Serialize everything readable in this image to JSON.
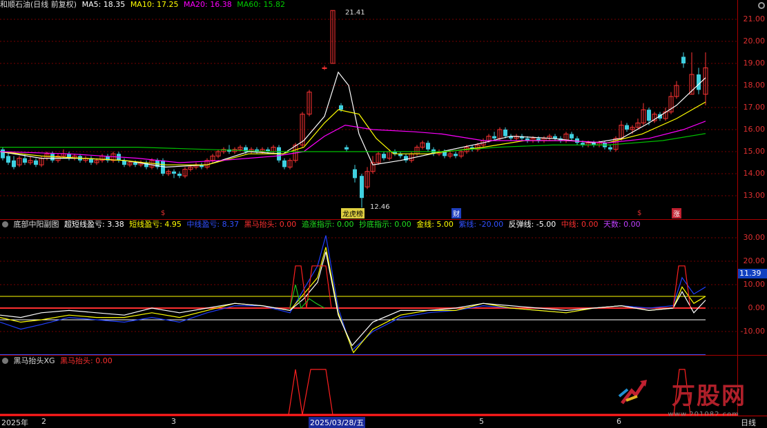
{
  "main_legend": {
    "title": "和顺石油(日线 前复权)",
    "ma5": "MA5: 18.35",
    "ma10": "MA10: 17.25",
    "ma20": "MA20: 16.38",
    "ma60": "MA60: 15.82"
  },
  "main_axis_ticks": [
    "21.00",
    "20.00",
    "19.00",
    "18.00",
    "17.00",
    "16.00",
    "15.00",
    "14.00",
    "13.00"
  ],
  "annotations": {
    "high": "21.41",
    "low": "12.46",
    "marker_1": "$",
    "marker_2": "$",
    "tag_rank": "龙虎榜",
    "tag_finance": "财",
    "tag_up": "涨"
  },
  "sub1_legend": {
    "name": "底部中阳副图",
    "item1": "超短线盈亏: 3.38",
    "item2": "短线盈亏: 4.95",
    "item3": "中线盈亏: 8.37",
    "item4": "黑马抬头: 0.00",
    "item5": "追涨指示: 0.00",
    "item6": "抄底指示: 0.00",
    "item7": "金线: 5.00",
    "item8": "紫线: -20.00",
    "item9": "反弹线: -5.00",
    "item10": "中线: 0.00",
    "item11": "天数: 0.00"
  },
  "sub1_axis_ticks": [
    "30.00",
    "20.00",
    "10.00",
    "0.00",
    "-10.00"
  ],
  "sub1_current": "11.39",
  "sub2_legend": {
    "name": "黑马抬头XG",
    "item1": "黑马抬头: 0.00"
  },
  "date_axis": {
    "d1": "2025年",
    "d2": "2",
    "d3": "3",
    "d4": "2025/03/28/五",
    "d5": "5",
    "d6": "6",
    "period": "日线"
  },
  "watermark": {
    "logo": "万股网",
    "url": "www.201082.com"
  },
  "colors": {
    "up": "#ff3333",
    "down": "#3fd0e0",
    "ma5": "#ffffff",
    "ma10": "#ffff00",
    "ma20": "#ff00ff",
    "ma60": "#00c000"
  }
}
